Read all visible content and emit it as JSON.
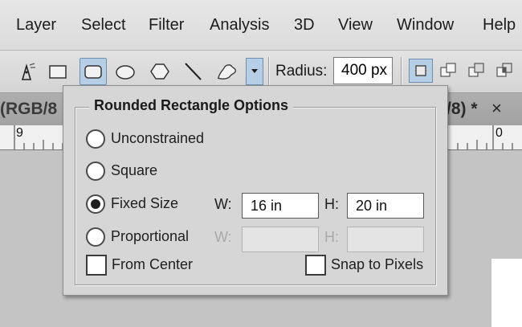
{
  "menu": {
    "items": [
      "Layer",
      "Select",
      "Filter",
      "Analysis",
      "3D",
      "View",
      "Window",
      "Help"
    ]
  },
  "options_bar": {
    "tools": [
      "pen-tool-icon",
      "rectangle-tool-icon",
      "rounded-rectangle-tool-icon",
      "ellipse-tool-icon",
      "polygon-tool-icon",
      "line-tool-icon",
      "custom-shape-tool-icon"
    ],
    "selected_tool": "rounded-rectangle-tool-icon",
    "radius_label": "Radius:",
    "radius_value": "400 px",
    "accent": "#b6cfe6"
  },
  "document": {
    "tab_left": "(RGB/8",
    "tab_right": "/8) *",
    "close_glyph": "×",
    "ruler_left": "9",
    "ruler_right": "0"
  },
  "panel": {
    "title": "Rounded Rectangle Options",
    "options": [
      {
        "label": "Unconstrained",
        "checked": false
      },
      {
        "label": "Square",
        "checked": false
      },
      {
        "label": "Fixed Size",
        "checked": true
      },
      {
        "label": "Proportional",
        "checked": false
      }
    ],
    "fixed_size": {
      "w_label": "W:",
      "w_value": "16 in",
      "h_label": "H:",
      "h_value": "20 in"
    },
    "proportional": {
      "w_label": "W:",
      "w_value": "",
      "h_label": "H:",
      "h_value": ""
    },
    "from_center_label": "From Center",
    "snap_label": "Snap to Pixels"
  }
}
